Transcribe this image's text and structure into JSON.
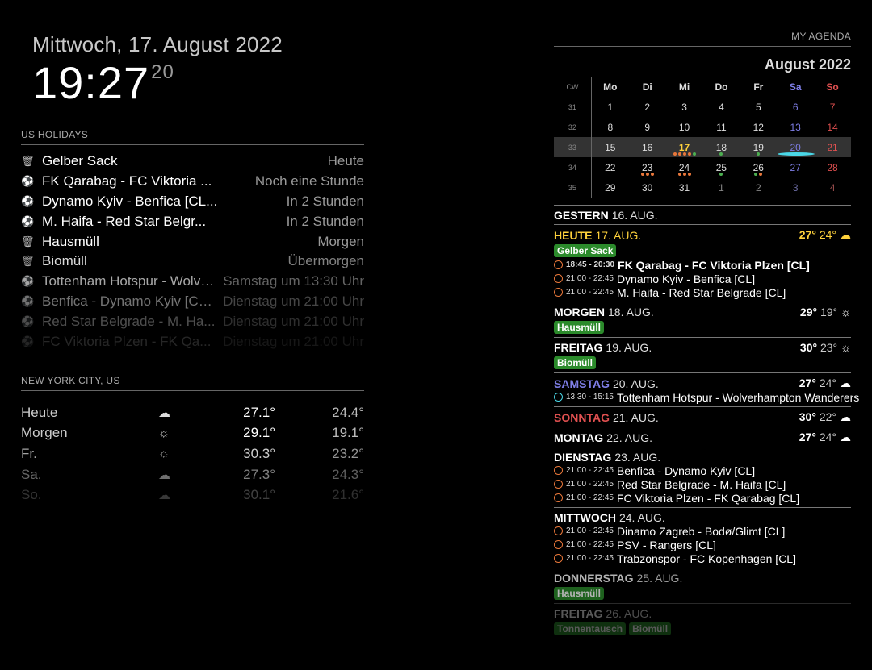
{
  "clock": {
    "date": "Mittwoch, 17. August 2022",
    "time": "19:27",
    "seconds": "20"
  },
  "holidays": {
    "header": "US HOLIDAYS",
    "items": [
      {
        "icon": "trash-icon",
        "title": "Gelber Sack",
        "when": "Heute",
        "opacity": 1
      },
      {
        "icon": "soccer-ball-icon",
        "title": "FK Qarabag - FC Viktoria ...",
        "when": "Noch eine Stunde",
        "opacity": 1
      },
      {
        "icon": "soccer-ball-icon",
        "title": "Dynamo Kyiv - Benfica [CL...",
        "when": "In 2 Stunden",
        "opacity": 1
      },
      {
        "icon": "soccer-ball-icon",
        "title": "M. Haifa - Red Star Belgr...",
        "when": "In 2 Stunden",
        "opacity": 1
      },
      {
        "icon": "trash-icon",
        "title": "Hausmüll",
        "when": "Morgen",
        "opacity": 1
      },
      {
        "icon": "trash-icon",
        "title": "Biomüll",
        "when": "Übermorgen",
        "opacity": 0.85
      },
      {
        "icon": "soccer-ball-icon",
        "title": "Tottenham Hotspur - Wolve...",
        "when": "Samstag um 13:30 Uhr",
        "opacity": 0.65
      },
      {
        "icon": "soccer-ball-icon",
        "title": "Benfica - Dynamo Kyiv [CL...",
        "when": "Dienstag um 21:00 Uhr",
        "opacity": 0.45
      },
      {
        "icon": "soccer-ball-icon",
        "title": "Red Star Belgrade - M. Ha...",
        "when": "Dienstag um 21:00 Uhr",
        "opacity": 0.3
      },
      {
        "icon": "soccer-ball-icon",
        "title": "FC Viktoria Plzen - FK Qa...",
        "when": "Dienstag um 21:00 Uhr",
        "opacity": 0.15
      }
    ]
  },
  "weather": {
    "header": "NEW YORK CITY, US",
    "days": [
      {
        "day": "Heute",
        "icon": "cloud-wind-icon",
        "glyph": "☁",
        "max": "27.1°",
        "min": "24.4°",
        "opacity": 1
      },
      {
        "day": "Morgen",
        "icon": "sun-icon",
        "glyph": "☼",
        "max": "29.1°",
        "min": "19.1°",
        "opacity": 1
      },
      {
        "day": "Fr.",
        "icon": "sun-icon",
        "glyph": "☼",
        "max": "30.3°",
        "min": "23.2°",
        "opacity": 0.8
      },
      {
        "day": "Sa.",
        "icon": "cloud-wind-icon",
        "glyph": "☁",
        "max": "27.3°",
        "min": "24.3°",
        "opacity": 0.5
      },
      {
        "day": "So.",
        "icon": "cloud-wind-icon",
        "glyph": "☁",
        "max": "30.1°",
        "min": "21.6°",
        "opacity": 0.25
      }
    ]
  },
  "agenda": {
    "title": "MY AGENDA",
    "month": "August 2022",
    "weekdays": [
      "CW",
      "Mo",
      "Di",
      "Mi",
      "Do",
      "Fr",
      "Sa",
      "So"
    ],
    "weeks": [
      {
        "cw": "31",
        "days": [
          "1",
          "2",
          "3",
          "4",
          "5",
          "6",
          "7"
        ]
      },
      {
        "cw": "32",
        "days": [
          "8",
          "9",
          "10",
          "11",
          "12",
          "13",
          "14"
        ]
      },
      {
        "cw": "33",
        "days": [
          "15",
          "16",
          "17",
          "18",
          "19",
          "20",
          "21"
        ],
        "current": true
      },
      {
        "cw": "34",
        "days": [
          "22",
          "23",
          "24",
          "25",
          "26",
          "27",
          "28"
        ]
      },
      {
        "cw": "35",
        "days": [
          "29",
          "30",
          "31",
          "1",
          "2",
          "3",
          "4"
        ],
        "dimFrom": 3
      }
    ],
    "days": [
      {
        "name": "GESTERN",
        "date": "16. AUG.",
        "color": "#ffffff",
        "opacity": 1,
        "tags": [],
        "events": []
      },
      {
        "name": "HEUTE",
        "date": "17. AUG.",
        "color": "#ffd23c",
        "opacity": 1,
        "hi": "27°",
        "lo": "24°",
        "wicon": "cloud-wind-icon",
        "wglyph": "☁",
        "wcolor": "#ffd23c",
        "tags": [
          "Gelber Sack"
        ],
        "events": [
          {
            "time": "18:45 - 20:30",
            "title": "FK Qarabag - FC Viktoria Plzen [CL]",
            "bold": true,
            "icon": "o"
          },
          {
            "time": "21:00 - 22:45",
            "title": "Dynamo Kyiv - Benfica [CL]",
            "icon": "o"
          },
          {
            "time": "21:00 - 22:45",
            "title": "M. Haifa - Red Star Belgrade [CL]",
            "icon": "o"
          }
        ]
      },
      {
        "name": "MORGEN",
        "date": "18. AUG.",
        "color": "#ffffff",
        "opacity": 1,
        "hi": "29°",
        "lo": "19°",
        "wicon": "sun-icon",
        "wglyph": "☼",
        "tags": [
          "Hausmüll"
        ],
        "events": []
      },
      {
        "name": "FREITAG",
        "date": "19. AUG.",
        "color": "#ffffff",
        "opacity": 1,
        "hi": "30°",
        "lo": "23°",
        "wicon": "sun-icon",
        "wglyph": "☼",
        "tags": [
          "Biomüll"
        ],
        "events": []
      },
      {
        "name": "SAMSTAG",
        "date": "20. AUG.",
        "color": "#7e7ee6",
        "opacity": 1,
        "hi": "27°",
        "lo": "24°",
        "wicon": "cloud-wind-icon",
        "wglyph": "☁",
        "tags": [],
        "events": [
          {
            "time": "13:30 - 15:15",
            "title": "Tottenham Hotspur - Wolverhampton Wanderers",
            "icon": "c"
          }
        ]
      },
      {
        "name": "SONNTAG",
        "date": "21. AUG.",
        "color": "#e05050",
        "opacity": 1,
        "hi": "30°",
        "lo": "22°",
        "wicon": "cloud-wind-icon",
        "wglyph": "☁",
        "tags": [],
        "events": []
      },
      {
        "name": "MONTAG",
        "date": "22. AUG.",
        "color": "#ffffff",
        "opacity": 1,
        "hi": "27°",
        "lo": "24°",
        "wicon": "cloud-wind-icon",
        "wglyph": "☁",
        "tags": [],
        "events": []
      },
      {
        "name": "DIENSTAG",
        "date": "23. AUG.",
        "color": "#ffffff",
        "opacity": 1,
        "tags": [],
        "events": [
          {
            "time": "21:00 - 22:45",
            "title": "Benfica - Dynamo Kyiv [CL]",
            "icon": "o"
          },
          {
            "time": "21:00 - 22:45",
            "title": "Red Star Belgrade - M. Haifa [CL]",
            "icon": "o"
          },
          {
            "time": "21:00 - 22:45",
            "title": "FC Viktoria Plzen - FK Qarabag [CL]",
            "icon": "o"
          }
        ]
      },
      {
        "name": "MITTWOCH",
        "date": "24. AUG.",
        "color": "#ffffff",
        "opacity": 1,
        "tags": [],
        "events": [
          {
            "time": "21:00 - 22:45",
            "title": "Dinamo Zagreb - Bodø/Glimt [CL]",
            "icon": "o"
          },
          {
            "time": "21:00 - 22:45",
            "title": "PSV - Rangers [CL]",
            "icon": "o"
          },
          {
            "time": "21:00 - 22:45",
            "title": "Trabzonspor - FC Kopenhagen [CL]",
            "icon": "o"
          }
        ]
      },
      {
        "name": "DONNERSTAG",
        "date": "25. AUG.",
        "color": "#ffffff",
        "opacity": 0.7,
        "tags": [
          "Hausmüll"
        ],
        "events": []
      },
      {
        "name": "FREITAG",
        "date": "26. AUG.",
        "color": "#ffffff",
        "opacity": 0.35,
        "tags": [
          "Tonnentausch",
          "Biomüll"
        ],
        "events": []
      }
    ]
  }
}
